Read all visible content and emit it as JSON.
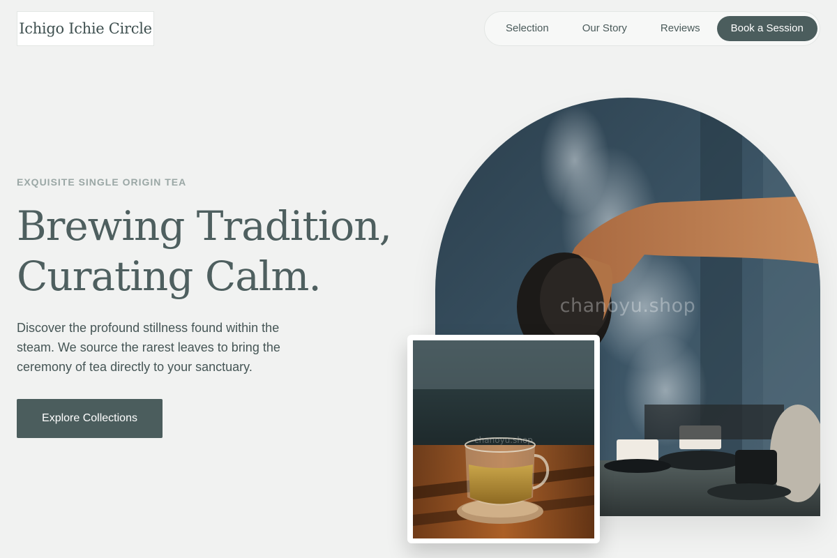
{
  "brand": {
    "name": "Ichigo Ichie Circle"
  },
  "nav": {
    "links": [
      "Selection",
      "Our Story",
      "Reviews"
    ],
    "cta_label": "Book a Session"
  },
  "hero": {
    "eyebrow": "EXQUISITE SINGLE ORIGIN TEA",
    "headline_line1": "Brewing Tradition,",
    "headline_line2": "Curating Calm.",
    "lede": "Discover the profound stillness found within the steam. We source the rarest leaves to bring the ceremony of tea directly to your sanctuary.",
    "cta_label": "Explore Collections"
  },
  "images": {
    "main_watermark": "chanoyu.shop",
    "card_watermark": "chanoyu.shop"
  },
  "colors": {
    "background": "#f1f2f1",
    "accent": "#4b5d5d",
    "eyebrow": "#9aa7a5"
  }
}
